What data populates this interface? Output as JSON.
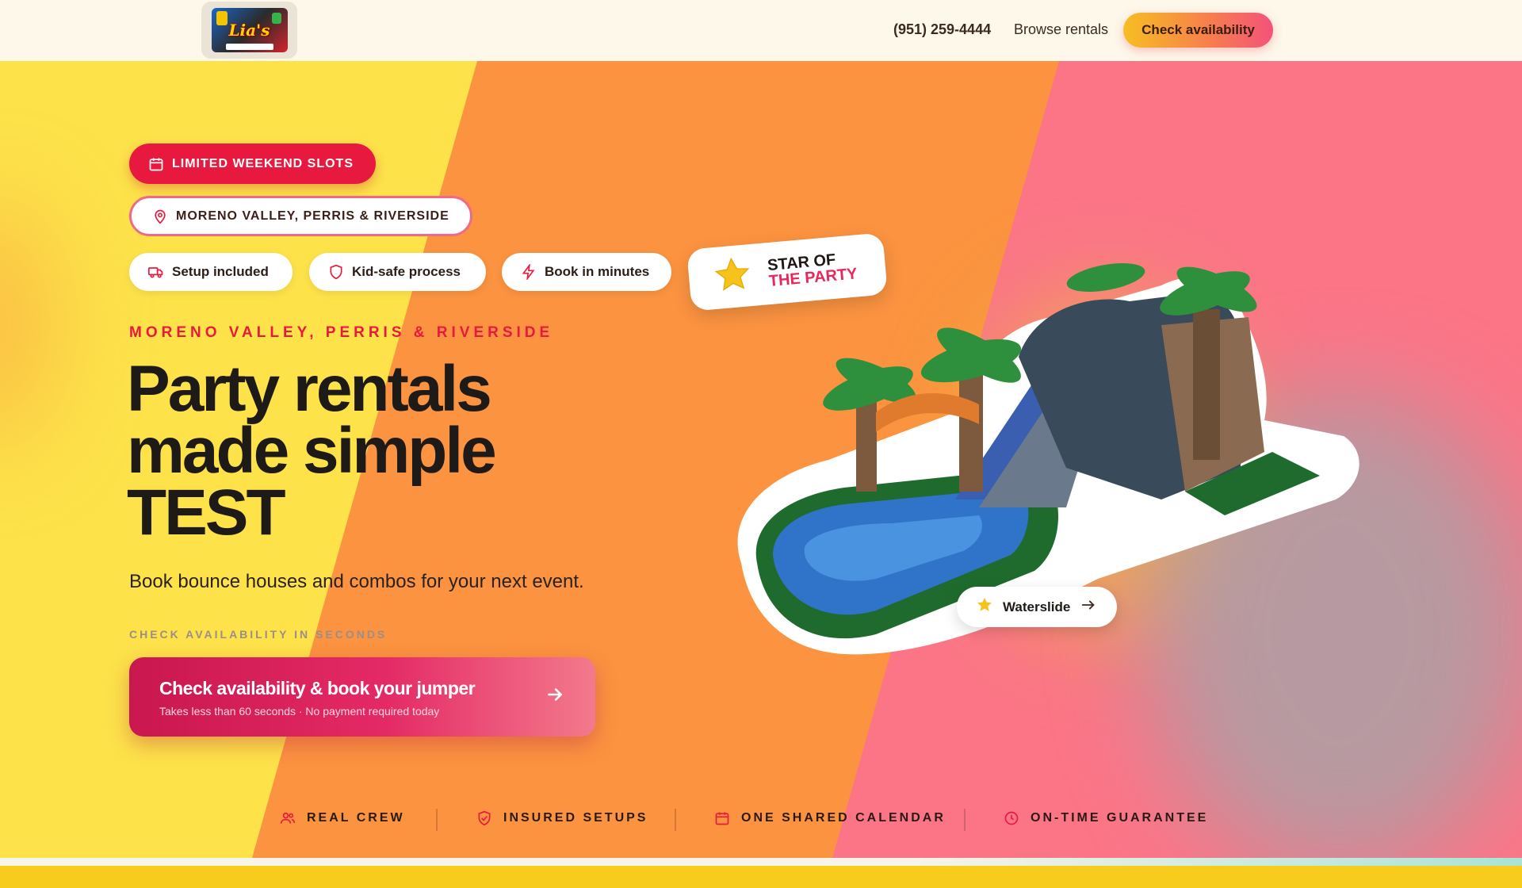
{
  "header": {
    "logo_text": "Lia's",
    "phone": "(951) 259-4444",
    "browse_label": "Browse rentals",
    "cta_label": "Check availability"
  },
  "hero": {
    "badge_limited": "LIMITED WEEKEND SLOTS",
    "badge_location": "MORENO VALLEY, PERRIS & RIVERSIDE",
    "chips": [
      {
        "label": "Setup included",
        "icon": "truck-icon"
      },
      {
        "label": "Kid-safe process",
        "icon": "shield-icon"
      },
      {
        "label": "Book in minutes",
        "icon": "lightning-icon"
      }
    ],
    "star_badge": {
      "line1": "STAR OF",
      "line2": "THE PARTY"
    },
    "eyebrow": "MORENO VALLEY, PERRIS & RIVERSIDE",
    "headline": [
      "Party rentals",
      "made simple",
      "TEST"
    ],
    "subline": "Book bounce houses and combos for your next event.",
    "check_label": "CHECK AVAILABILITY IN SECONDS",
    "cta": {
      "title": "Check availability & book your jumper",
      "subtitle": "Takes less than 60 seconds · No payment required today"
    },
    "product_chip": "Waterslide"
  },
  "trust_bar": [
    {
      "label": "REAL CREW",
      "icon": "people-icon"
    },
    {
      "label": "INSURED SETUPS",
      "icon": "shield-check-icon"
    },
    {
      "label": "ONE SHARED CALENDAR",
      "icon": "calendar-icon"
    },
    {
      "label": "ON-TIME GUARANTEE",
      "icon": "clock-icon"
    }
  ],
  "colors": {
    "accent_red": "#e8193e",
    "yellow": "#fde14a",
    "orange": "#fb9440",
    "pink": "#fb7186",
    "text_dark": "#1e1a17"
  }
}
